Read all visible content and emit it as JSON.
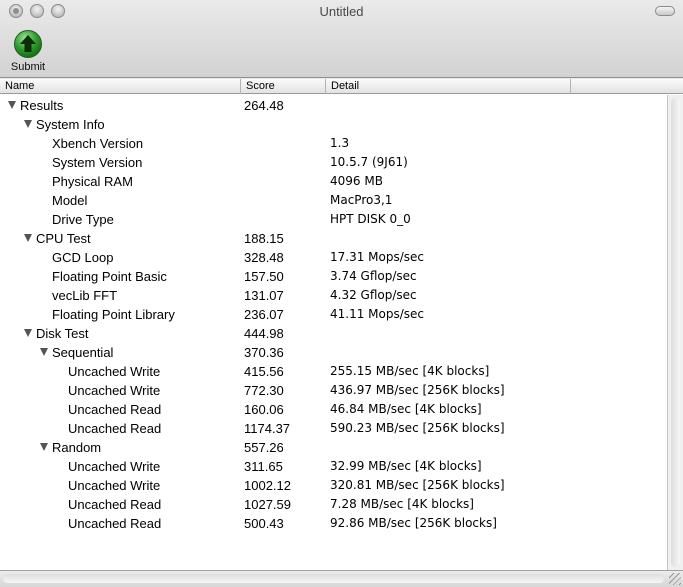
{
  "window": {
    "title": "Untitled"
  },
  "toolbar": {
    "submit_label": "Submit"
  },
  "columns": {
    "name": "Name",
    "score": "Score",
    "detail": "Detail",
    "extra": ""
  },
  "rows": [
    {
      "level": 0,
      "expandable": true,
      "name": "Results",
      "score": "264.48",
      "detail": ""
    },
    {
      "level": 1,
      "expandable": true,
      "name": "System Info",
      "score": "",
      "detail": ""
    },
    {
      "level": 2,
      "expandable": false,
      "name": "Xbench Version",
      "score": "",
      "detail": "1.3"
    },
    {
      "level": 2,
      "expandable": false,
      "name": "System Version",
      "score": "",
      "detail": "10.5.7 (9J61)"
    },
    {
      "level": 2,
      "expandable": false,
      "name": "Physical RAM",
      "score": "",
      "detail": "4096 MB"
    },
    {
      "level": 2,
      "expandable": false,
      "name": "Model",
      "score": "",
      "detail": "MacPro3,1"
    },
    {
      "level": 2,
      "expandable": false,
      "name": "Drive Type",
      "score": "",
      "detail": "HPT DISK 0_0"
    },
    {
      "level": 1,
      "expandable": true,
      "name": "CPU Test",
      "score": "188.15",
      "detail": ""
    },
    {
      "level": 2,
      "expandable": false,
      "name": "GCD Loop",
      "score": "328.48",
      "detail": "17.31 Mops/sec"
    },
    {
      "level": 2,
      "expandable": false,
      "name": "Floating Point Basic",
      "score": "157.50",
      "detail": "3.74 Gflop/sec"
    },
    {
      "level": 2,
      "expandable": false,
      "name": "vecLib FFT",
      "score": "131.07",
      "detail": "4.32 Gflop/sec"
    },
    {
      "level": 2,
      "expandable": false,
      "name": "Floating Point Library",
      "score": "236.07",
      "detail": "41.11 Mops/sec"
    },
    {
      "level": 1,
      "expandable": true,
      "name": "Disk Test",
      "score": "444.98",
      "detail": ""
    },
    {
      "level": 2,
      "expandable": true,
      "name": "Sequential",
      "score": "370.36",
      "detail": ""
    },
    {
      "level": 3,
      "expandable": false,
      "name": "Uncached Write",
      "score": "415.56",
      "detail": "255.15 MB/sec [4K blocks]"
    },
    {
      "level": 3,
      "expandable": false,
      "name": "Uncached Write",
      "score": "772.30",
      "detail": "436.97 MB/sec [256K blocks]"
    },
    {
      "level": 3,
      "expandable": false,
      "name": "Uncached Read",
      "score": "160.06",
      "detail": "46.84 MB/sec [4K blocks]"
    },
    {
      "level": 3,
      "expandable": false,
      "name": "Uncached Read",
      "score": "1174.37",
      "detail": "590.23 MB/sec [256K blocks]"
    },
    {
      "level": 2,
      "expandable": true,
      "name": "Random",
      "score": "557.26",
      "detail": ""
    },
    {
      "level": 3,
      "expandable": false,
      "name": "Uncached Write",
      "score": "311.65",
      "detail": "32.99 MB/sec [4K blocks]"
    },
    {
      "level": 3,
      "expandable": false,
      "name": "Uncached Write",
      "score": "1002.12",
      "detail": "320.81 MB/sec [256K blocks]"
    },
    {
      "level": 3,
      "expandable": false,
      "name": "Uncached Read",
      "score": "1027.59",
      "detail": "7.28 MB/sec [4K blocks]"
    },
    {
      "level": 3,
      "expandable": false,
      "name": "Uncached Read",
      "score": "500.43",
      "detail": "92.86 MB/sec [256K blocks]"
    }
  ],
  "colors": {
    "submit_green": "#2e9a2e",
    "disclosure": "#555555"
  },
  "icons": {
    "submit": "green-up-arrow-icon",
    "disclosure": "disclosure-triangle-icon"
  }
}
